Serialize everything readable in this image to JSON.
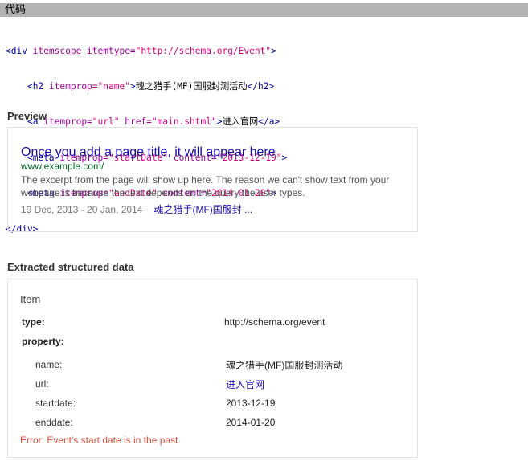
{
  "code_header": {
    "title": "代码"
  },
  "code": {
    "line1": {
      "open": "<div",
      "attr1": " itemscope itemtype=",
      "val1": "\"http://schema.org/Event\"",
      "close": ">"
    },
    "line2": {
      "open": "<h2",
      "attr1": " itemprop=",
      "val1": "\"name\"",
      "close": ">",
      "text": "魂之猎手(MF)国服封测活动",
      "end": "</h2>"
    },
    "line3": {
      "open": "<a",
      "attr1": " itemprop=",
      "val1": "\"url\"",
      "attr2": " href=",
      "val2": "\"main.shtml\"",
      "close": ">",
      "text": "进入官网",
      "end": "</a>"
    },
    "line4": {
      "open": "<meta",
      "attr1": " itemprop=",
      "val1": "\"startDate\"",
      "attr2": " content=",
      "val2": "\"2013-12-19\"",
      "close": ">"
    },
    "line5": {
      "open": "<meta",
      "attr1": " itemprop=",
      "val1": "\"endDate\"",
      "attr2": " content=",
      "val2": "\"2014-01-20\"",
      "close": ">"
    },
    "line6": {
      "end": "</div>"
    }
  },
  "preview": {
    "heading": "Preview",
    "title": "Once you add a page title, it will appear here",
    "url": "www.example.com/",
    "desc_line1": "The excerpt from the page will show up here. The reason we can't show text from your",
    "desc_line2": "webpage is because the text depends on the query the user types.",
    "date_range": "19 Dec, 2013 - 20 Jan, 2014",
    "event_link": "魂之猎手(MF)国服封 ..."
  },
  "extracted": {
    "heading": "Extracted structured data",
    "item_label": "Item",
    "type_label": "type:",
    "type_value": "http://schema.org/event",
    "property_label": "property:",
    "properties": [
      {
        "name": "name:",
        "value": "魂之猎手(MF)国服封测活动"
      },
      {
        "name": "url:",
        "value": "进入官网"
      },
      {
        "name": "startdate:",
        "value": "2013-12-19"
      },
      {
        "name": "enddate:",
        "value": "2014-01-20"
      }
    ],
    "error": "Error: Event's start date is in the past."
  }
}
